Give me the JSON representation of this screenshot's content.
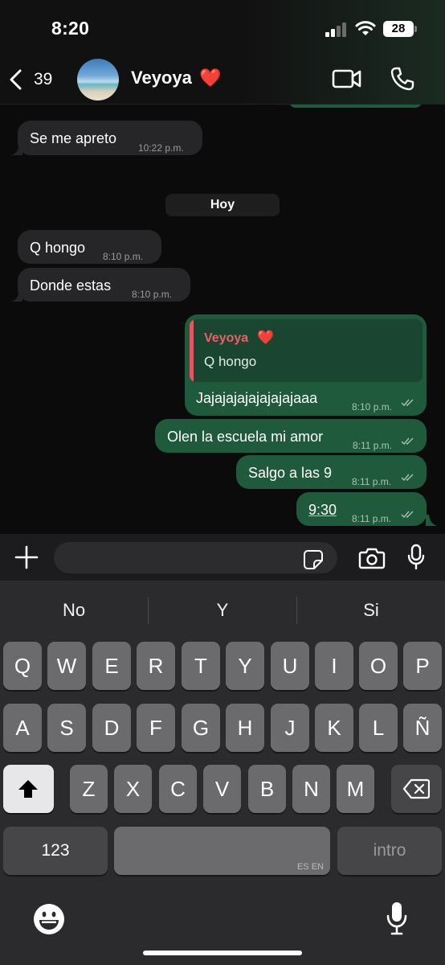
{
  "status_bar": {
    "time": "8:20",
    "battery": "28"
  },
  "header": {
    "back_count": "39",
    "contact_name": "Veyoya",
    "contact_emoji": "❤️",
    "icons": [
      "chevron-left-icon",
      "video-camera-icon",
      "phone-icon"
    ]
  },
  "chat": {
    "messages": [
      {
        "direction": "in",
        "text": "Se me apreto",
        "time": "10:22 p.m."
      },
      {
        "direction": "in",
        "text": "Q hongo",
        "time": "8:10 p.m."
      },
      {
        "direction": "in",
        "text": "Donde estas",
        "time": "8:10 p.m."
      },
      {
        "direction": "out",
        "text": "Jajajajajajajajajaaa",
        "time": "8:10 p.m.",
        "reply_to": {
          "name": "Veyoya",
          "emoji": "❤️",
          "text": "Q hongo"
        }
      },
      {
        "direction": "out",
        "text": "Olen la escuela mi amor",
        "time": "8:11 p.m."
      },
      {
        "direction": "out",
        "text": "Salgo a las 9",
        "time": "8:11 p.m."
      },
      {
        "direction": "out",
        "text": "9:30",
        "time": "8:11 p.m."
      }
    ],
    "day_separator": "Hoy"
  },
  "input_bar": {
    "placeholder": "",
    "icons": [
      "plus-icon",
      "sticker-icon",
      "camera-icon",
      "microphone-icon"
    ]
  },
  "keyboard": {
    "suggestions": [
      "No",
      "Y",
      "Si"
    ],
    "row1": [
      "Q",
      "W",
      "E",
      "R",
      "T",
      "Y",
      "U",
      "I",
      "O",
      "P"
    ],
    "row2": [
      "A",
      "S",
      "D",
      "F",
      "G",
      "H",
      "J",
      "K",
      "L",
      "Ñ"
    ],
    "row3": [
      "Z",
      "X",
      "C",
      "V",
      "B",
      "N",
      "M"
    ],
    "numbers_label": "123",
    "space_label": "ES EN",
    "return_label": "intro",
    "icons": [
      "shift-icon",
      "backspace-icon",
      "emoji-icon",
      "dictation-mic-icon"
    ]
  },
  "colors": {
    "outgoing_bubble": "#1f5a3c",
    "incoming_bubble": "#262628",
    "reply_accent": "#e25561"
  }
}
